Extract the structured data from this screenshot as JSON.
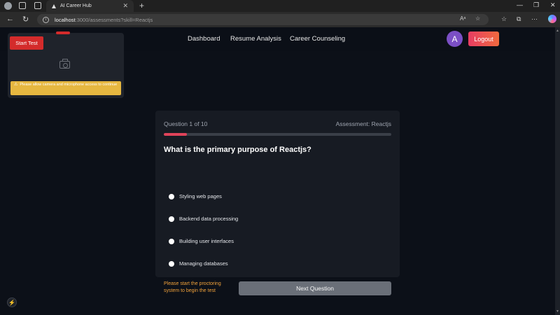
{
  "browser": {
    "tab_title": "AI Career Hub",
    "url_host": "localhost",
    "url_path": ":3000/assessments?skill=Reactjs",
    "reader_label": "Aᵃ"
  },
  "navbar": {
    "links": [
      "Dashboard",
      "Resume Analysis",
      "Career Counseling"
    ],
    "avatar_initial": "A",
    "logout_label": "Logout",
    "accent_color": "#e83d63"
  },
  "proctor": {
    "start_label": "Start Test",
    "warning_text": "Please allow camera and microphone access to continue",
    "warning_color": "#e6b740"
  },
  "quiz": {
    "question_counter": "Question 1 of 10",
    "assessment_label": "Assessment: Reactjs",
    "progress_fraction": 0.1,
    "question": "What is the primary purpose of Reactjs?",
    "options": [
      "Styling web pages",
      "Backend data processing",
      "Building user interfaces",
      "Managing databases"
    ],
    "start_message": "Please start the proctoring system to begin the test",
    "next_label": "Next Question"
  }
}
